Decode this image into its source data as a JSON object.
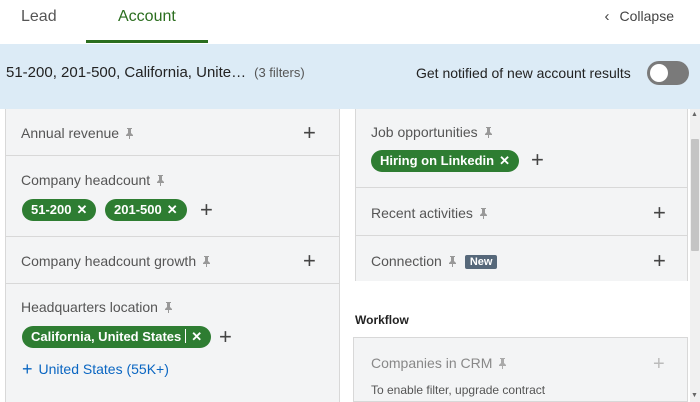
{
  "tabs": {
    "lead": "Lead",
    "account": "Account",
    "collapse": "Collapse"
  },
  "summary": {
    "text": "51-200, 201-500, California, Unite…",
    "count": "(3 filters)",
    "notify_label": "Get notified of new account results",
    "notify_on": false
  },
  "left_filters": {
    "annual_revenue": "Annual revenue",
    "headcount": "Company headcount",
    "headcount_chips": [
      "51-200",
      "201-500"
    ],
    "headcount_growth": "Company headcount growth",
    "hq_location": "Headquarters location",
    "hq_chip": "California, United States",
    "hq_suggestion": "United States (55K+)"
  },
  "right_filters": {
    "job_opportunities": "Job opportunities",
    "job_chip": "Hiring on Linkedin",
    "recent_activities": "Recent activities",
    "connection": "Connection",
    "connection_badge": "New"
  },
  "workflow": {
    "heading": "Workflow",
    "crm_label": "Companies in CRM",
    "crm_sub": "To enable filter, upgrade contract"
  },
  "colors": {
    "accent_green": "#2e7d32",
    "summary_bg": "#dcebf6",
    "link_blue": "#0a66c2"
  }
}
